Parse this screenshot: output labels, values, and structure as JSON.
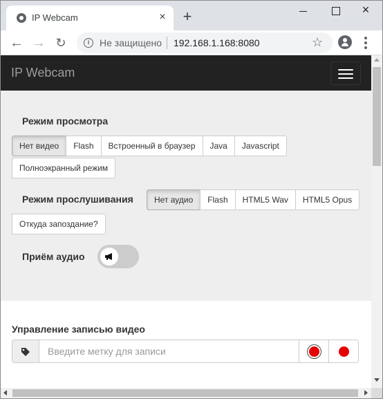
{
  "browser": {
    "tab_title": "IP Webcam",
    "security_label": "Не защищено",
    "url": "192.168.1.168:8080",
    "new_tab_symbol": "+",
    "tab_close_symbol": "×"
  },
  "navbar": {
    "brand": "IP Webcam"
  },
  "view_mode": {
    "label": "Режим просмотра",
    "options": [
      "Нет видео",
      "Flash",
      "Встроенный в браузер",
      "Java",
      "Javascript"
    ],
    "extra_option": "Полноэкранный режим",
    "selected": "Нет видео"
  },
  "listen_mode": {
    "label": "Режим прослушивания",
    "options": [
      "Нет аудио",
      "Flash",
      "HTML5 Wav",
      "HTML5 Opus"
    ],
    "selected": "Нет аудио",
    "delay_button": "Откуда запоздание?"
  },
  "audio_receive": {
    "label": "Приём аудио",
    "enabled": false
  },
  "recording": {
    "title": "Управление записью видео",
    "placeholder": "Введите метку для записи"
  },
  "icons": {
    "tag": "tag-icon",
    "record": "record-icon",
    "megaphone": "megaphone-icon"
  },
  "colors": {
    "navbar_bg": "#222222",
    "record_red": "#e60000",
    "panel_bg": "#eeeeee"
  }
}
